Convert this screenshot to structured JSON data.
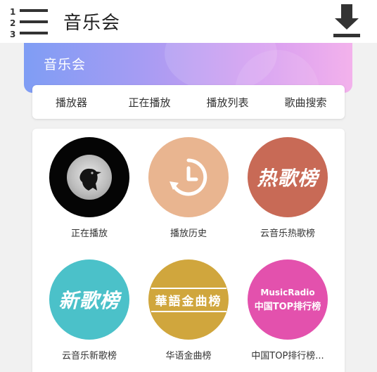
{
  "appbar": {
    "title": "音乐会",
    "menu_icon": "numbered-list-icon",
    "download_icon": "download-icon"
  },
  "banner": {
    "title": "音乐会",
    "gradient": [
      "#7f9df4",
      "#a59cf3",
      "#d49cf1",
      "#f3b2ec"
    ]
  },
  "tabs": [
    {
      "label": "播放器"
    },
    {
      "label": "正在播放"
    },
    {
      "label": "播放列表"
    },
    {
      "label": "歌曲搜索"
    }
  ],
  "grid": [
    {
      "label": "正在播放",
      "color": "#050505",
      "icon": "crow-album-icon"
    },
    {
      "label": "播放历史",
      "color": "#e9b590",
      "icon": "history-clock-icon"
    },
    {
      "label": "云音乐热歌榜",
      "color": "#c86a56",
      "logo_text": "热歌榜"
    },
    {
      "label": "云音乐新歌榜",
      "color": "#4bc1c9",
      "logo_text": "新歌榜"
    },
    {
      "label": "华语金曲榜",
      "color": "#d0a63d",
      "logo_text": "華語金曲榜"
    },
    {
      "label": "中国TOP排行榜...",
      "color": "#e351ad",
      "logo_line1": "MusicRadio",
      "logo_line2": "中国TOP排行榜"
    }
  ]
}
